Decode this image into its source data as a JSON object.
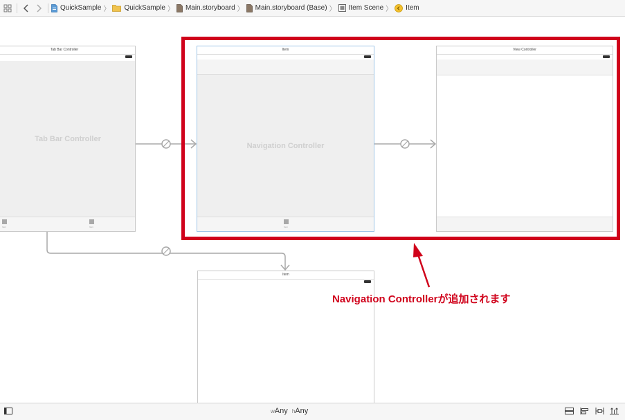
{
  "jump_bar": {
    "breadcrumbs": [
      {
        "label": "QuickSample",
        "icon": "project-file-icon"
      },
      {
        "label": "QuickSample",
        "icon": "folder-icon"
      },
      {
        "label": "Main.storyboard",
        "icon": "storyboard-file-icon"
      },
      {
        "label": "Main.storyboard (Base)",
        "icon": "storyboard-file-icon"
      },
      {
        "label": "Item Scene",
        "icon": "scene-icon"
      },
      {
        "label": "Item",
        "icon": "view-controller-icon"
      }
    ]
  },
  "canvas": {
    "scenes": {
      "tab_bar_controller": {
        "title": "Tab Bar Controller",
        "placeholder": "Tab Bar Controller",
        "tab_items": [
          "Item",
          "Item"
        ]
      },
      "navigation_controller": {
        "title": "Item",
        "placeholder": "Navigation Controller",
        "tab_items": [
          "Item"
        ]
      },
      "view_controller": {
        "title": "View Controller"
      },
      "item_scene_bottom": {
        "title": "Item"
      }
    }
  },
  "annotation": {
    "text": "Navigation Controllerが追加されます",
    "color": "#d0021b"
  },
  "bottom_bar": {
    "width_prefix": "w",
    "width_value": "Any",
    "height_prefix": "h",
    "height_value": "Any"
  }
}
